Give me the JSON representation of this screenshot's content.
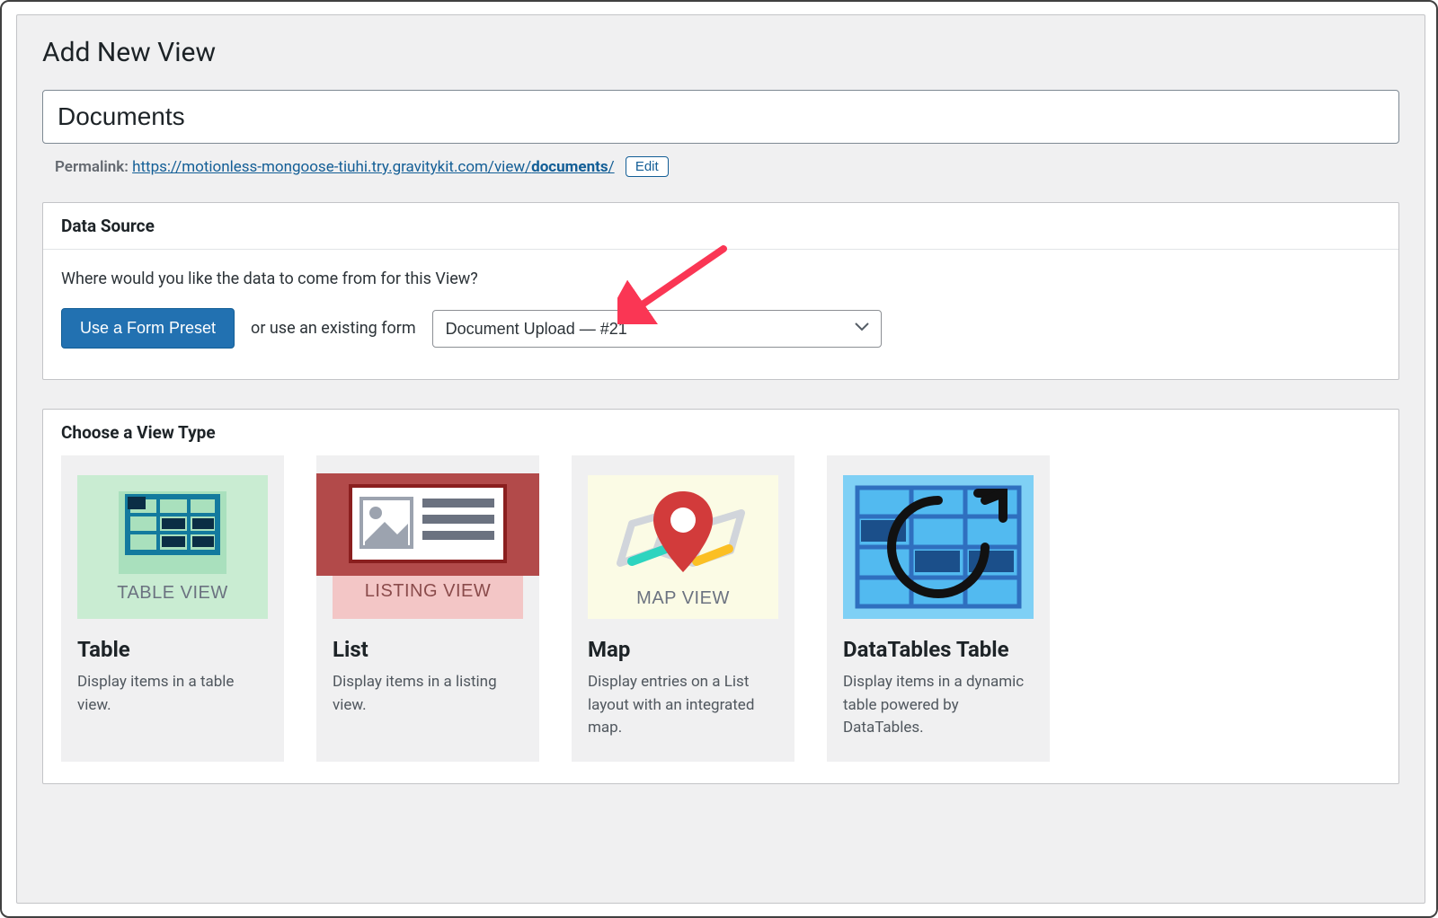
{
  "page": {
    "title": "Add New View"
  },
  "editor": {
    "title_value": "Documents",
    "permalink_label": "Permalink:",
    "permalink_base": "https://motionless-mongoose-tiuhi.try.gravitykit.com/view/",
    "permalink_slug": "documents",
    "permalink_trailing": "/",
    "edit_label": "Edit"
  },
  "data_source": {
    "panel_title": "Data Source",
    "prompt": "Where would you like the data to come from for this View?",
    "preset_button": "Use a Form Preset",
    "or_text": "or use an existing form",
    "selected_form": "Document Upload — #21"
  },
  "view_type": {
    "panel_title": "Choose a View Type",
    "options": [
      {
        "caption": "TABLE VIEW",
        "title": "Table",
        "desc": "Display items in a table view."
      },
      {
        "caption": "LISTING VIEW",
        "title": "List",
        "desc": "Display items in a listing view."
      },
      {
        "caption": "MAP VIEW",
        "title": "Map",
        "desc": "Display entries on a List layout with an integrated map."
      },
      {
        "caption": "",
        "title": "DataTables Table",
        "desc": "Display items in a dynamic table powered by DataTables."
      }
    ]
  }
}
